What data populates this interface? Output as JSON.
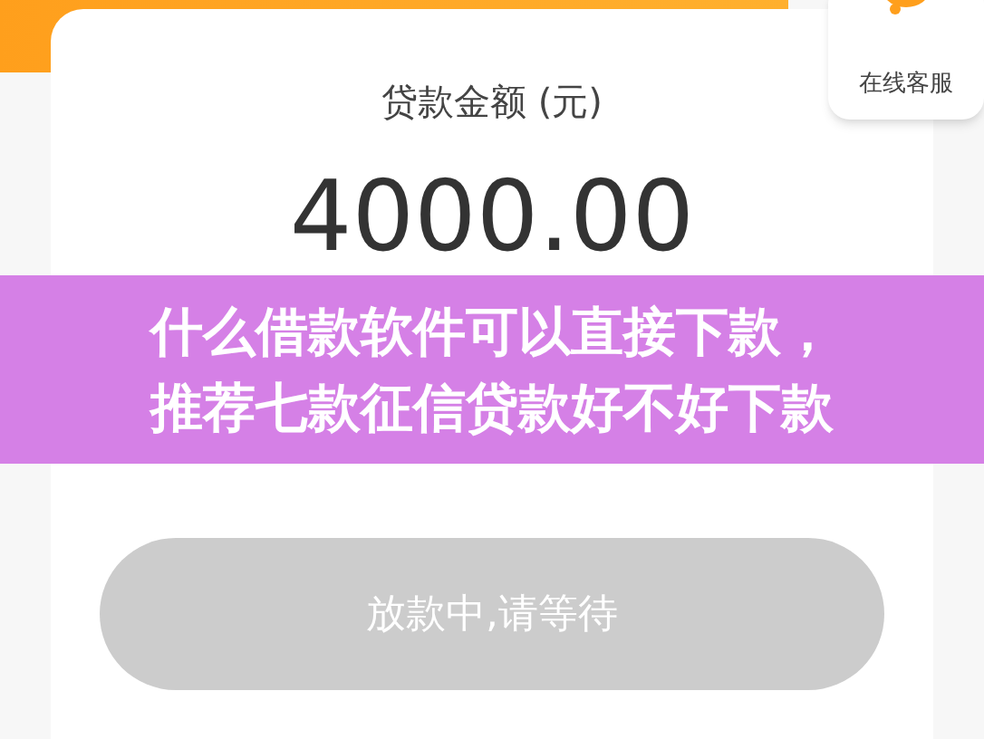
{
  "customer_service": {
    "label": "在线客服"
  },
  "loan": {
    "label": "贷款金额 (元)",
    "amount": "4000.00"
  },
  "action_button": {
    "label": "放款中,请等待",
    "disabled": true
  },
  "overlay_title": {
    "lines": [
      "什么借款软件可以直接下款，",
      "推荐七款征信贷款好不好下款"
    ]
  }
}
